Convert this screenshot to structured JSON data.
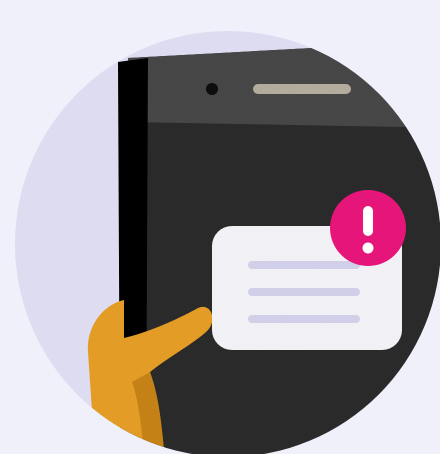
{
  "illustration": {
    "subject": "phone-notification-alert",
    "colors": {
      "background": "#f0f0fa",
      "circle": "#dedcf0",
      "phone_body": "#2e2e2e",
      "phone_top": "#4a4a4a",
      "phone_edge": "#0e0e0e",
      "speaker": "#b8b0a0",
      "camera": "#141414",
      "bubble": "#f7f7fb",
      "bubble_lines": "#d6d4ee",
      "alert_badge": "#e6157a",
      "alert_mark": "#ffffff",
      "hand": "#e8a02a",
      "hand_shadow": "#c9851c"
    },
    "icons": {
      "phone": "phone-icon",
      "message": "message-bubble-icon",
      "alert": "exclamation-badge-icon",
      "hand": "hand-icon"
    }
  }
}
